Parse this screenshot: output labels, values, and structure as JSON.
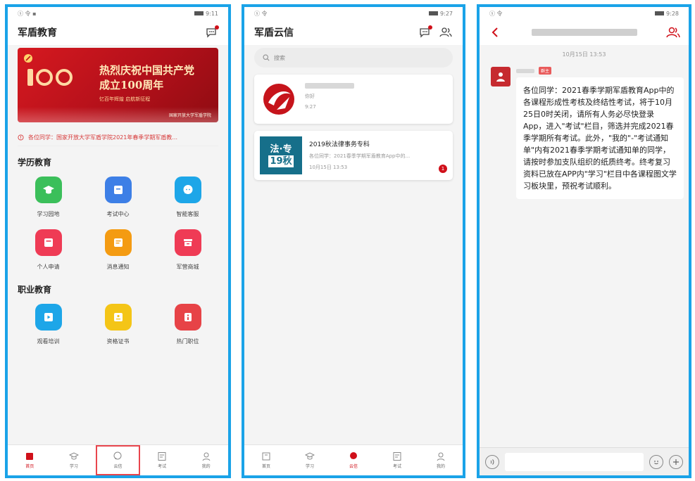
{
  "screen1": {
    "status_left": "ⓢ 令 ▪",
    "status_time": "9:11",
    "title": "军盾教育",
    "banner": {
      "headline_line1": "热烈庆祝中国共产党",
      "headline_line2": "成立100周年",
      "subline": "忆百年辉煌 启航新征程",
      "footer": "国家开放大学军盾学院"
    },
    "notice": "各位同学：国家开放大学军盾学院2021年春季学期军盾教...",
    "section1_title": "学历教育",
    "section1_items": [
      {
        "label": "学习园地",
        "icon": "graduation-cap-icon",
        "color": "#3bbf5a"
      },
      {
        "label": "考试中心",
        "icon": "exam-icon",
        "color": "#3d7fe6"
      },
      {
        "label": "智能客服",
        "icon": "chat-bubble-icon",
        "color": "#1da6e8"
      },
      {
        "label": "个人申请",
        "icon": "card-icon",
        "color": "#ef3b55"
      },
      {
        "label": "消息通知",
        "icon": "notice-icon",
        "color": "#f49b12"
      },
      {
        "label": "军营商城",
        "icon": "store-icon",
        "color": "#ef3b55"
      }
    ],
    "section2_title": "职业教育",
    "section2_items": [
      {
        "label": "观看培训",
        "icon": "video-icon",
        "color": "#1da6e8"
      },
      {
        "label": "资格证书",
        "icon": "certificate-icon",
        "color": "#f4c517"
      },
      {
        "label": "热门职位",
        "icon": "job-icon",
        "color": "#e74347"
      }
    ],
    "tabs": [
      "首页",
      "学习",
      "云信",
      "考试",
      "我的"
    ]
  },
  "screen2": {
    "status_left": "ⓢ 令",
    "status_time": "9:27",
    "title": "军盾云信",
    "search_placeholder": "搜索",
    "conversations": [
      {
        "name": "",
        "preview": "你好",
        "time": "9:27",
        "avatar": "logo-avatar"
      },
      {
        "name": "2019秋法律事务专科",
        "preview": "各位同学：2021春季学期军盾教育App中的...",
        "time": "10月15日 13:53",
        "badge": "1",
        "avatar_line1": "法·专",
        "avatar_line2": "19秋"
      }
    ],
    "tabs": [
      "首页",
      "学习",
      "云信",
      "考试",
      "我的"
    ]
  },
  "screen3": {
    "status_left": "ⓢ 令",
    "status_time": "9:28",
    "chat_time": "10月15日 13:53",
    "sender_tag": "群主",
    "message": "各位同学：2021春季学期军盾教育App中的各课程形成性考核及终结性考试，将于10月25日0时关闭，请所有人务必尽快登录App，进入\"考试\"栏目，筛选并完成2021春季学期所有考试。此外，\"我的\"-\"考试通知单\"内有2021春季学期考试通知单的同学，请按时参加支队组织的纸质终考。终考复习资料已放在APP内\"学习\"栏目中各课程图文学习板块里，预祝考试顺利。"
  },
  "colors": {
    "frame": "#1aa3e8",
    "accent": "#d0101a"
  }
}
